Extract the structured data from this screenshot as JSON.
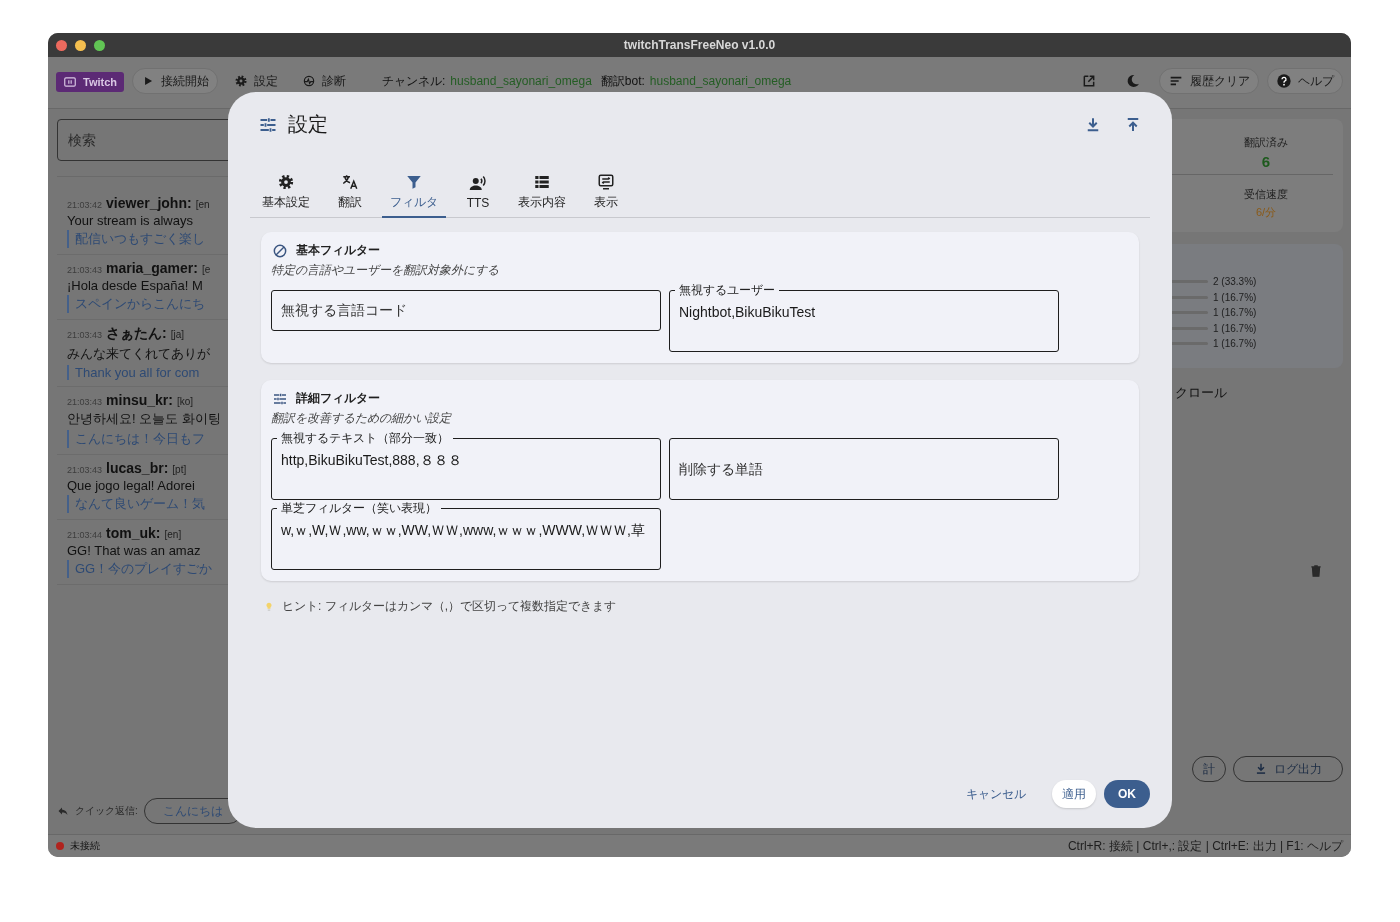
{
  "window": {
    "title": "twitchTransFreeNeo v1.0.0"
  },
  "toolbar": {
    "left": [
      {
        "kind": "brand",
        "label": "Twitch"
      },
      {
        "kind": "connect",
        "label": "接続開始"
      },
      {
        "kind": "settings",
        "label": "設定"
      },
      {
        "kind": "diagnostics",
        "label": "診断"
      }
    ],
    "channel": {
      "label": "チャンネル:",
      "value": "husband_sayonari_omega"
    },
    "bot": {
      "label": "翻訳bot:",
      "value": "husband_sayonari_omega"
    },
    "right": [
      {
        "kind": "popout"
      },
      {
        "kind": "theme"
      },
      {
        "kind": "clear",
        "label": "履歴クリア"
      },
      {
        "kind": "help",
        "label": "ヘルプ"
      }
    ]
  },
  "chat": {
    "search": {
      "placeholder": "検索"
    },
    "messages": [
      {
        "time": "21:03:42",
        "user": "viewer_john:",
        "lang": "[en",
        "text": "Your stream is always",
        "translation": "配信いつもすごく楽し"
      },
      {
        "time": "21:03:43",
        "user": "maria_gamer:",
        "lang": "[e",
        "text": "¡Hola desde España! M",
        "translation": "スペインからこんにち"
      },
      {
        "time": "21:03:43",
        "user": "さぁたん:",
        "lang": "[ja]",
        "text": "みんな来てくれてありが",
        "translation": "Thank you all for com"
      },
      {
        "time": "21:03:43",
        "user": "minsu_kr:",
        "lang": "[ko]",
        "text": "안녕하세요! 오늘도 화이팅",
        "translation": "こんにちは！今日もフ"
      },
      {
        "time": "21:03:43",
        "user": "lucas_br:",
        "lang": "[pt]",
        "text": "Que jogo legal! Adorei",
        "translation": "なんて良いゲーム！気"
      },
      {
        "time": "21:03:44",
        "user": "tom_uk:",
        "lang": "[en]",
        "text": "GG! That was an amaz",
        "translation": "GG！今のプレイすごか"
      }
    ]
  },
  "quick_reply": {
    "label": "クイック返信:",
    "options": [
      "こんにちは"
    ]
  },
  "stats": {
    "items": [
      {
        "kind": "count",
        "label": "翻訳済み",
        "value": "6"
      },
      {
        "kind": "rate",
        "label": "受信速度",
        "value": "6/分"
      }
    ]
  },
  "languages": {
    "rows": [
      "2 (33.3%)",
      "1 (16.7%)",
      "1 (16.7%)",
      "1 (16.7%)",
      "1 (16.7%)"
    ]
  },
  "auto_scroll": {
    "label": "クロール"
  },
  "actions": [
    {
      "kind": "stats",
      "label": "計"
    },
    {
      "kind": "export",
      "label": "ログ出力"
    }
  ],
  "status_bar": {
    "connected": false,
    "status": "未接続",
    "shortcuts": "Ctrl+R: 接続 | Ctrl+,: 設定 | Ctrl+E: 出力 | F1: ヘルプ"
  },
  "settings_dialog": {
    "title": "設定",
    "tabs": [
      {
        "kind": "general",
        "label": "基本設定",
        "selected": false
      },
      {
        "kind": "translate",
        "label": "翻訳",
        "selected": false
      },
      {
        "kind": "filter",
        "label": "フィルタ",
        "selected": true
      },
      {
        "kind": "tts",
        "label": "TTS",
        "selected": false
      },
      {
        "kind": "content",
        "label": "表示内容",
        "selected": false
      },
      {
        "kind": "display",
        "label": "表示",
        "selected": false
      }
    ],
    "sections": [
      {
        "kind": "block",
        "title": "基本フィルター",
        "subtitle": "特定の言語やユーザーを翻訳対象外にする",
        "fields": [
          {
            "kind": "line",
            "placeholder": "無視する言語コード"
          },
          {
            "kind": "area",
            "label": "無視するユーザー",
            "value": "Nightbot,BikuBikuTest"
          }
        ]
      },
      {
        "kind": "tune",
        "title": "詳細フィルター",
        "subtitle": "翻訳を改善するための細かい設定",
        "fields": [
          {
            "kind": "area",
            "label": "無視するテキスト（部分一致）",
            "value": "http,BikuBikuTest,888,８８８"
          },
          {
            "kind": "area",
            "placeholder": "削除する単語"
          },
          {
            "kind": "area",
            "label": "単芝フィルター（笑い表現）",
            "value": "w,ｗ,W,Ｗ,ww,ｗｗ,WW,ＷＷ,www,ｗｗｗ,WWW,ＷＷＷ,草"
          }
        ]
      }
    ],
    "hint": "ヒント: フィルターはカンマ（,）で区切って複数指定できます",
    "buttons": [
      {
        "kind": "text",
        "label": "キャンセル"
      },
      {
        "kind": "tonal",
        "label": "適用"
      },
      {
        "kind": "filled",
        "label": "OK"
      }
    ]
  }
}
